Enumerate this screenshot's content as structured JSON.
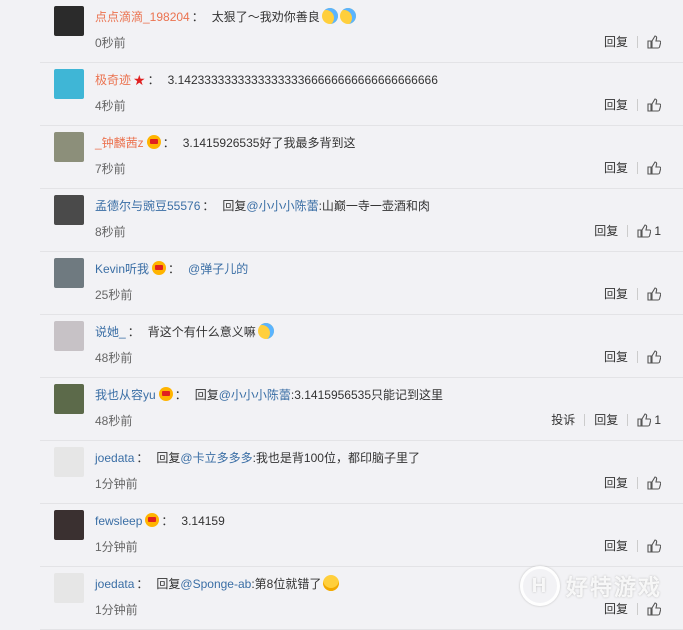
{
  "comments": [
    {
      "name": "点点滴滴_198204",
      "badge": "",
      "reply_prefix": "",
      "mention": "",
      "text": "太狠了～我劝你善良",
      "emojis": 2,
      "time": "0秒前",
      "report": "",
      "reply": "回复",
      "likes": ""
    },
    {
      "name": "极奇迹",
      "badge": "star",
      "reply_prefix": "",
      "mention": "",
      "text": "3.142333333333333333366666666666666666666",
      "emojis": 0,
      "time": "4秒前",
      "report": "",
      "reply": "回复",
      "likes": ""
    },
    {
      "name": "_钟麟茜z",
      "badge": "vip",
      "reply_prefix": "",
      "mention": "",
      "text": "3.1415926535好了我最多背到这",
      "emojis": 0,
      "time": "7秒前",
      "report": "",
      "reply": "回复",
      "likes": ""
    },
    {
      "name": "孟德尔与豌豆55576",
      "badge": "",
      "reply_prefix": "回复",
      "mention": "@小小小陈蕾",
      "text": ":山巅一寺一壶酒和肉",
      "emojis": 0,
      "time": "8秒前",
      "report": "",
      "reply": "回复",
      "likes": "1"
    },
    {
      "name": "Kevin听我",
      "badge": "vip",
      "reply_prefix": "",
      "mention": "@弹子儿的",
      "text": "",
      "emojis": 0,
      "time": "25秒前",
      "report": "",
      "reply": "回复",
      "likes": ""
    },
    {
      "name": "说她_",
      "badge": "",
      "reply_prefix": "",
      "mention": "",
      "text": "背这个有什么意义嘛",
      "emojis": 1,
      "time": "48秒前",
      "report": "",
      "reply": "回复",
      "likes": ""
    },
    {
      "name": "我也从容yu",
      "badge": "vip",
      "reply_prefix": "回复",
      "mention": "@小小小陈蕾",
      "text": ":3.1415956535只能记到这里",
      "emojis": 0,
      "time": "48秒前",
      "report": "投诉",
      "reply": "回复",
      "likes": "1"
    },
    {
      "name": "joedata",
      "badge": "",
      "reply_prefix": "回复",
      "mention": "@卡立多多多",
      "text": ":我也是背100位，都印脑子里了",
      "emojis": 0,
      "time": "1分钟前",
      "report": "",
      "reply": "回复",
      "likes": ""
    },
    {
      "name": "fewsleep",
      "badge": "vip",
      "reply_prefix": "",
      "mention": "",
      "text": "3.14159",
      "emojis": 0,
      "time": "1分钟前",
      "report": "",
      "reply": "回复",
      "likes": ""
    },
    {
      "name": "joedata",
      "badge": "",
      "reply_prefix": "回复",
      "mention": "@Sponge-ab",
      "text": ":第8位就错了",
      "emojis": 1,
      "time": "1分钟前",
      "report": "",
      "reply": "回复",
      "likes": ""
    }
  ],
  "avatars": [
    "#2b2b2b",
    "#3fb6d6",
    "#8c8f7a",
    "#4a4a4a",
    "#6f7a80",
    "#c7c2c6",
    "#5c6a4a",
    "#e6e6e6",
    "#3a3030",
    "#e6e6e6"
  ],
  "watermark": {
    "logo": "H",
    "text": "好特游戏"
  },
  "colors": {
    "link": "#3a6ea5",
    "name": "#eb7350",
    "background": "#f2f2f5"
  }
}
